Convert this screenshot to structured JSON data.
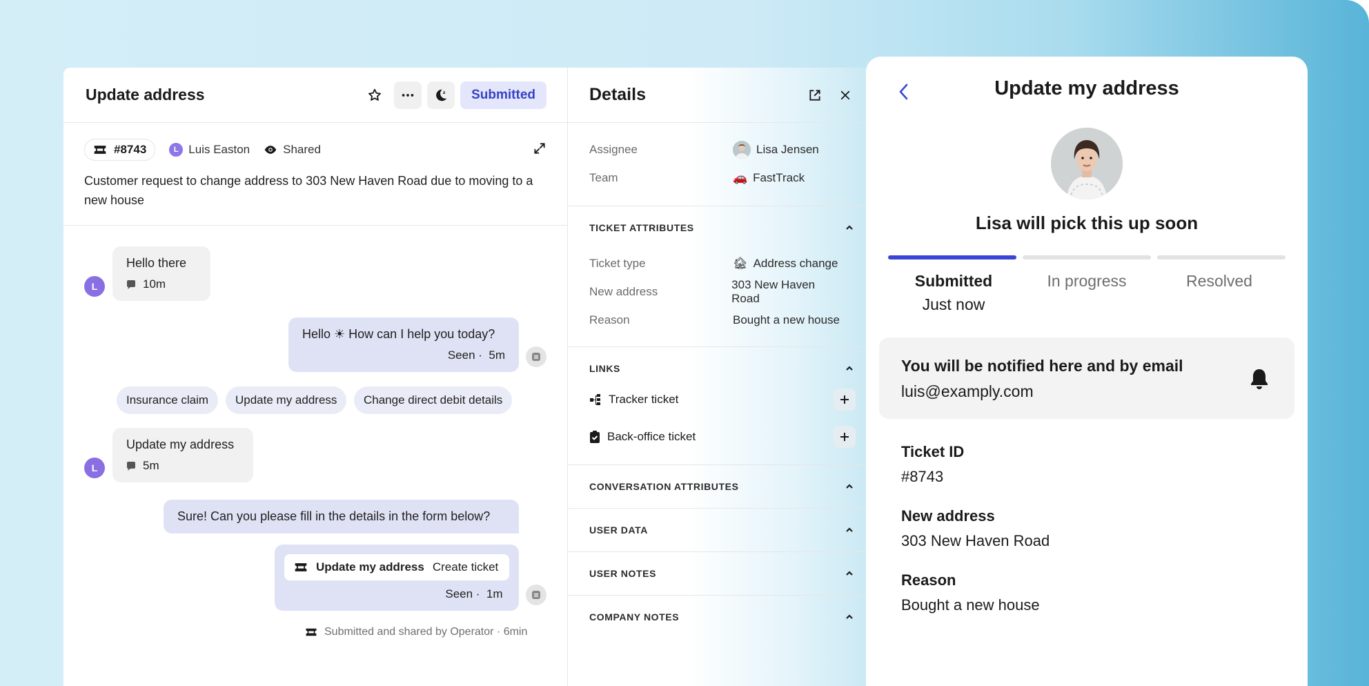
{
  "conversation": {
    "title": "Update address",
    "status": "Submitted",
    "ticket_number": "#8743",
    "user_initial": "L",
    "user_name": "Luis Easton",
    "visibility": "Shared",
    "description": "Customer request to change address to 303 New Haven Road due to moving to a new house",
    "messages": [
      {
        "text": "Hello there",
        "time": "10m"
      },
      {
        "text": "Hello ☀ How can I help you today?",
        "seen": "Seen ·",
        "time": "5m"
      },
      {
        "text": "Update my address",
        "time": "5m"
      },
      {
        "text": "Sure! Can you please fill in the details in the form below?"
      }
    ],
    "quick_replies": [
      "Insurance claim",
      "Update my address",
      "Change direct debit details"
    ],
    "ticket_card": {
      "title": "Update my address",
      "action": "Create ticket",
      "seen": "Seen ·",
      "time": "1m"
    },
    "footer_note": "Submitted and shared by Operator · 6min"
  },
  "details": {
    "title": "Details",
    "assignee_label": "Assignee",
    "assignee_value": "Lisa Jensen",
    "team_label": "Team",
    "team_icon": "🚗",
    "team_value": "FastTrack",
    "ticket_attributes": {
      "heading": "TICKET ATTRIBUTES",
      "rows": [
        {
          "label": "Ticket type",
          "icon": "🏚",
          "value": "Address change"
        },
        {
          "label": "New address",
          "value": "303 New Haven Road"
        },
        {
          "label": "Reason",
          "value": "Bought a new house"
        }
      ]
    },
    "links": {
      "heading": "LINKS",
      "items": [
        "Tracker ticket",
        "Back-office ticket"
      ]
    },
    "sections": [
      "CONVERSATION ATTRIBUTES",
      "USER DATA",
      "USER NOTES",
      "COMPANY NOTES"
    ]
  },
  "messenger": {
    "title": "Update my address",
    "pickup_text": "Lisa will pick this up soon",
    "steps": [
      "Submitted",
      "In progress",
      "Resolved"
    ],
    "step_time": "Just now",
    "notify_title": "You will be notified here and by email",
    "notify_email": "luis@examply.com",
    "fields": [
      {
        "label": "Ticket ID",
        "value": "#8743"
      },
      {
        "label": "New address",
        "value": "303 New Haven Road"
      },
      {
        "label": "Reason",
        "value": "Bought a new house"
      }
    ]
  },
  "colors": {
    "accent": "#3845d6",
    "status_bg": "#e4e7fb",
    "user_avatar": "#8a6fe3",
    "operator_bubble": "#dfe2f5"
  }
}
